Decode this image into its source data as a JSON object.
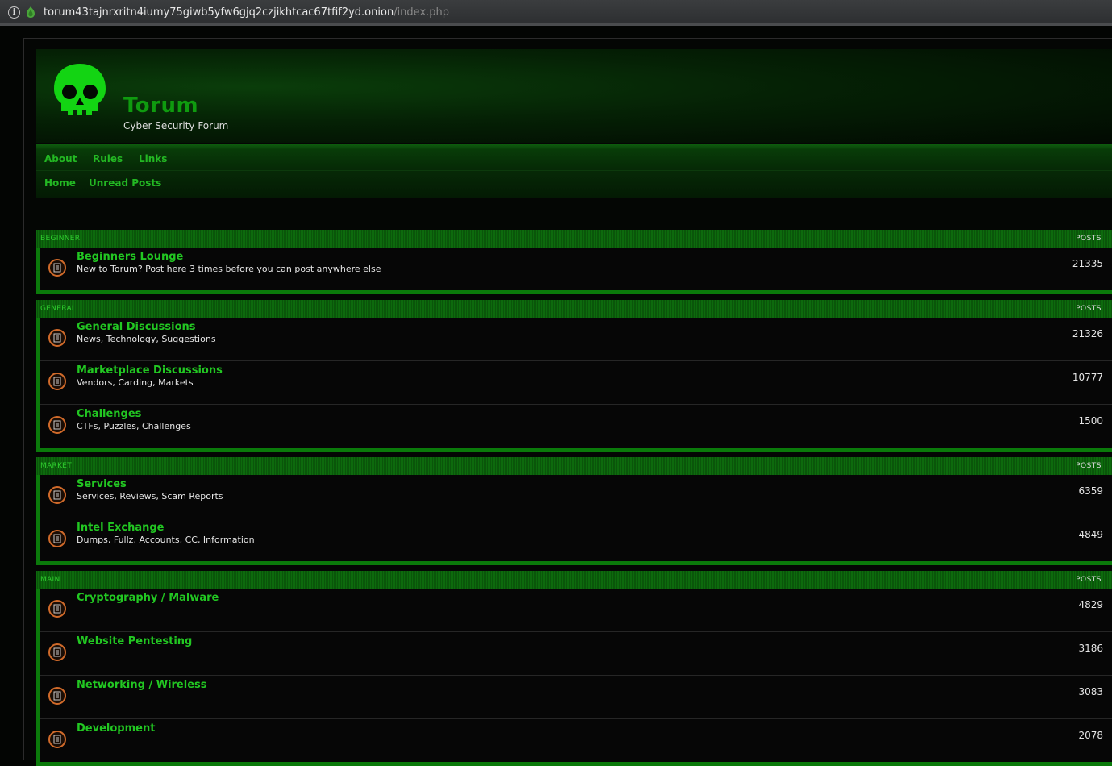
{
  "browser": {
    "url_host": "torum43tajnrxritn4iumy75giwb5yfw6gjq2czjikhtcac67tfif2yd.onion",
    "url_path": "/index.php"
  },
  "site": {
    "title": "Torum",
    "subtitle": "Cyber Security Forum",
    "accent_color": "#22c722"
  },
  "nav": {
    "row1": [
      "About",
      "Rules",
      "Links"
    ],
    "row2": [
      "Home",
      "Unread Posts"
    ]
  },
  "sections": [
    {
      "category": "BEGINNER",
      "posts_label": "POSTS",
      "forums": [
        {
          "name": "Beginners Lounge",
          "desc": "New to Torum? Post here 3 times before you can post anywhere else",
          "posts": "21335"
        }
      ]
    },
    {
      "category": "GENERAL",
      "posts_label": "POSTS",
      "forums": [
        {
          "name": "General Discussions",
          "desc": "News, Technology, Suggestions",
          "posts": "21326"
        },
        {
          "name": "Marketplace Discussions",
          "desc": "Vendors, Carding, Markets",
          "posts": "10777"
        },
        {
          "name": "Challenges",
          "desc": "CTFs, Puzzles, Challenges",
          "posts": "1500"
        }
      ]
    },
    {
      "category": "MARKET",
      "posts_label": "POSTS",
      "forums": [
        {
          "name": "Services",
          "desc": "Services, Reviews, Scam Reports",
          "posts": "6359"
        },
        {
          "name": "Intel Exchange",
          "desc": "Dumps, Fullz, Accounts, CC, Information",
          "posts": "4849"
        }
      ]
    },
    {
      "category": "MAIN",
      "posts_label": "POSTS",
      "forums": [
        {
          "name": "Cryptography / Malware",
          "desc": "",
          "posts": "4829"
        },
        {
          "name": "Website Pentesting",
          "desc": "",
          "posts": "3186"
        },
        {
          "name": "Networking / Wireless",
          "desc": "",
          "posts": "3083"
        },
        {
          "name": "Development",
          "desc": "",
          "posts": "2078"
        }
      ]
    }
  ]
}
